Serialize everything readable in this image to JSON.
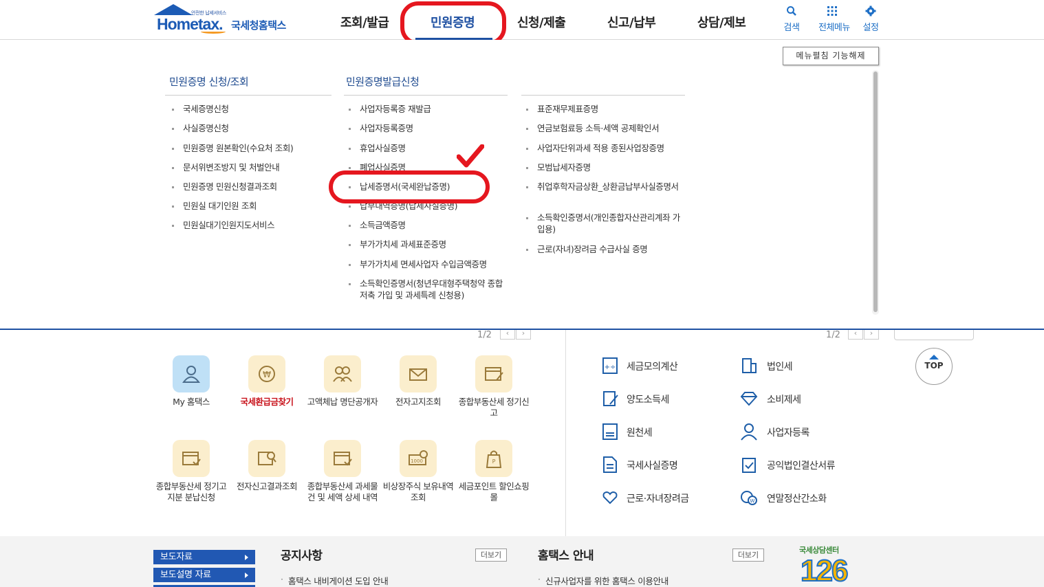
{
  "header": {
    "logo_small": "안전한 납세서비스",
    "logo_main": "Hometax.",
    "logo_sub": "국세청홈택스",
    "nav": [
      "조회/발급",
      "민원증명",
      "신청/제출",
      "신고/납부",
      "상담/제보"
    ],
    "active_nav": "민원증명",
    "utils": [
      {
        "label": "검색",
        "icon": "search-icon"
      },
      {
        "label": "전체메뉴",
        "icon": "grid-icon"
      },
      {
        "label": "설정",
        "icon": "gear-icon"
      }
    ]
  },
  "mega_menu": {
    "unfix_button": "메뉴펼침 기능해제",
    "col1_title": "민원증명 신청/조회",
    "col1_items": [
      "국세증명신청",
      "사실증명신청",
      "민원증명 원본확인(수요처 조회)",
      "문서위변조방지 및 처벌안내",
      "민원증명 민원신청결과조회",
      "민원실 대기인원 조회",
      "민원실대기인원지도서비스"
    ],
    "col2_title": "민원증명발급신청",
    "col2_items": [
      "사업자등록증 재발급",
      "사업자등록증명",
      "휴업사실증명",
      "폐업사실증명",
      "납세증명서(국세완납증명)",
      "납부내역증명(납세사실증명)",
      "소득금액증명",
      "부가가치세 과세표준증명",
      "부가가치세 면세사업자 수입금액증명",
      "소득확인증명서(청년우대형주택청약 종합저축 가입 및 과세특례 신청용)"
    ],
    "col3_items": [
      "표준재무제표증명",
      "연금보험료등 소득·세액 공제확인서",
      "사업자단위과세 적용 종된사업장증명",
      "모범납세자증명",
      "취업후학자금상환_상환금납부사실증명서",
      "소득확인증명서(개인종합자산관리계좌 가입용)",
      "근로(자녀)장려금 수급사실 증명"
    ],
    "highlighted_item": "납세증명서(국세완납증명)"
  },
  "quick_menu": {
    "pager": "1/2",
    "items": [
      {
        "label": "My 홈택스",
        "icon": "person-icon"
      },
      {
        "label": "국세환급금찾기",
        "icon": "refund-icon"
      },
      {
        "label": "고액체납 명단공개자",
        "icon": "people-icon"
      },
      {
        "label": "전자고지조회",
        "icon": "mail-icon"
      },
      {
        "label": "종합부동산세 정기신고",
        "icon": "calendar-edit-icon"
      },
      {
        "label": "종합부동산세 정기고지분 분납신청",
        "icon": "calendar-check-icon"
      },
      {
        "label": "전자신고결과조회",
        "icon": "search-doc-icon"
      },
      {
        "label": "종합부동산세 과세물건 및 세액 상세 내역",
        "icon": "calendar-check-icon"
      },
      {
        "label": "비상장주식 보유내역 조회",
        "icon": "stock-icon"
      },
      {
        "label": "세금포인트 할인쇼핑몰",
        "icon": "shopping-bag-icon"
      }
    ]
  },
  "tax_menu": {
    "pager": "1/2",
    "items": [
      {
        "label": "세금모의계산",
        "icon": "calculator-icon"
      },
      {
        "label": "법인세",
        "icon": "building-icon"
      },
      {
        "label": "양도소득세",
        "icon": "doc-edit-icon"
      },
      {
        "label": "소비제세",
        "icon": "diamond-icon"
      },
      {
        "label": "원천세",
        "icon": "receipt-icon"
      },
      {
        "label": "사업자등록",
        "icon": "user-icon"
      },
      {
        "label": "국세사실증명",
        "icon": "document-icon"
      },
      {
        "label": "공익법인결산서류",
        "icon": "clipboard-icon"
      },
      {
        "label": "근로·자녀장려금",
        "icon": "heart-hand-icon"
      },
      {
        "label": "연말정산간소화",
        "icon": "coin-search-icon"
      }
    ]
  },
  "top_button": "TOP",
  "footer": {
    "buttons": [
      "보도자료",
      "보도설명 자료"
    ],
    "notice_title": "공지사항",
    "notice_more": "더보기",
    "notice_item": "홈택스 내비게이션 도입 안내",
    "guide_title": "홈택스 안내",
    "guide_more": "더보기",
    "guide_item": "신규사업자를 위한 홈택스 이용안내",
    "center_logo_text": "국세상담센터",
    "center_number": "126"
  },
  "colors": {
    "brand_blue": "#1e50a2",
    "highlight_red": "#e5171f",
    "icon_bg": "#fbeecd"
  }
}
